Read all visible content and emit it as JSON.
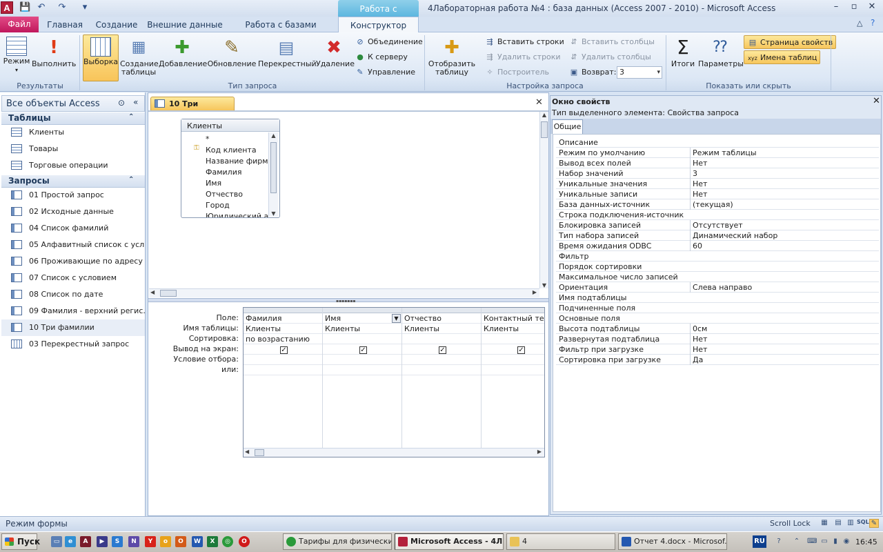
{
  "window": {
    "app_icon": "A",
    "context_tab": "Работа с запросами",
    "title": "4Лабораторная работа №4 : база данных (Access 2007 - 2010)  -  Microsoft Access",
    "minimize": "–",
    "maximize": "▫",
    "close": "✕"
  },
  "quick_access": [
    "save-icon",
    "undo-icon",
    "redo-icon",
    "customize-icon"
  ],
  "tabs": {
    "file": "Файл",
    "home": "Главная",
    "create": "Создание",
    "external": "Внешние данные",
    "database": "Работа с базами данных",
    "designer": "Конструктор"
  },
  "ribbon": {
    "results": {
      "label": "Результаты",
      "view": "Режим",
      "run": "Выполнить"
    },
    "query_type": {
      "label": "Тип запроса",
      "select": "Выборка",
      "make_table_1": "Создание",
      "make_table_2": "таблицы",
      "append": "Добавление",
      "update": "Обновление",
      "crosstab": "Перекрестный",
      "delete": "Удаление",
      "union": "Объединение",
      "pass_through": "К серверу",
      "data_definition": "Управление"
    },
    "query_setup": {
      "label": "Настройка запроса",
      "show_table_1": "Отобразить",
      "show_table_2": "таблицу",
      "insert_rows": "Вставить строки",
      "delete_rows": "Удалить строки",
      "builder": "Построитель",
      "insert_columns": "Вставить столбцы",
      "delete_columns": "Удалить столбцы",
      "return_label": "Возврат:",
      "return_value": "3"
    },
    "show_hide": {
      "label": "Показать или скрыть",
      "totals": "Итоги",
      "parameters": "Параметры",
      "property_sheet": "Страница свойств",
      "table_names": "Имена таблиц"
    }
  },
  "nav": {
    "header": "Все объекты Access",
    "tables_label": "Таблицы",
    "tables": [
      "Клиенты",
      "Товары",
      "Торговые операции"
    ],
    "queries_label": "Запросы",
    "queries": [
      "01 Простой запрос",
      "02 Исходные данные",
      "04 Список фамилий",
      "05 Алфавитный список с усл...",
      "06 Проживающие по адресу",
      "07 Список с условием",
      "08 Список по дате",
      "09 Фамилия - верхний регис...",
      "10 Три фамилии",
      "03 Перекрестный запрос"
    ]
  },
  "document": {
    "tab_title": "10 Три фамилии",
    "table_box": {
      "name": "Клиенты",
      "fields": [
        "*",
        "Код клиента",
        "Название фирмы",
        "Фамилия",
        "Имя",
        "Отчество",
        "Город",
        "Юридический адрес"
      ]
    },
    "grid": {
      "row_labels": [
        "Поле:",
        "Имя таблицы:",
        "Сортировка:",
        "Вывод на экран:",
        "Условие отбора:",
        "или:"
      ],
      "columns": [
        {
          "field": "Фамилия",
          "table": "Клиенты",
          "sort": "по возрастанию",
          "show": true
        },
        {
          "field": "Имя",
          "table": "Клиенты",
          "sort": "",
          "show": true
        },
        {
          "field": "Отчество",
          "table": "Клиенты",
          "sort": "",
          "show": true
        },
        {
          "field": "Контактный телефон",
          "table": "Клиенты",
          "sort": "",
          "show": true
        }
      ]
    }
  },
  "property_sheet": {
    "title": "Окно свойств",
    "subtitle": "Тип выделенного элемента:  Свойства запроса",
    "tab": "Общие",
    "rows": [
      [
        "Описание",
        ""
      ],
      [
        "Режим по умолчанию",
        "Режим таблицы"
      ],
      [
        "Вывод всех полей",
        "Нет"
      ],
      [
        "Набор значений",
        "3"
      ],
      [
        "Уникальные значения",
        "Нет"
      ],
      [
        "Уникальные записи",
        "Нет"
      ],
      [
        "База данных-источник",
        "(текущая)"
      ],
      [
        "Строка подключения-источник",
        ""
      ],
      [
        "Блокировка записей",
        "Отсутствует"
      ],
      [
        "Тип набора записей",
        "Динамический набор"
      ],
      [
        "Время ожидания ODBC",
        "60"
      ],
      [
        "Фильтр",
        ""
      ],
      [
        "Порядок сортировки",
        ""
      ],
      [
        "Максимальное число записей",
        ""
      ],
      [
        "Ориентация",
        "Слева направо"
      ],
      [
        "Имя подтаблицы",
        ""
      ],
      [
        "Подчиненные поля",
        ""
      ],
      [
        "Основные поля",
        ""
      ],
      [
        "Высота подтаблицы",
        "0см"
      ],
      [
        "Развернутая подтаблица",
        "Нет"
      ],
      [
        "Фильтр при загрузке",
        "Нет"
      ],
      [
        "Сортировка при загрузке",
        "Да"
      ]
    ]
  },
  "status": {
    "text": "Режим формы",
    "scroll_lock": "Scroll Lock",
    "sql": "SQL"
  },
  "taskbar": {
    "start": "Пуск",
    "tasks": [
      "Тарифы для физически...",
      "Microsoft Access - 4Л...",
      "4",
      "Отчет 4.docx - Microsof..."
    ],
    "lang": "RU",
    "clock": "16:45"
  }
}
